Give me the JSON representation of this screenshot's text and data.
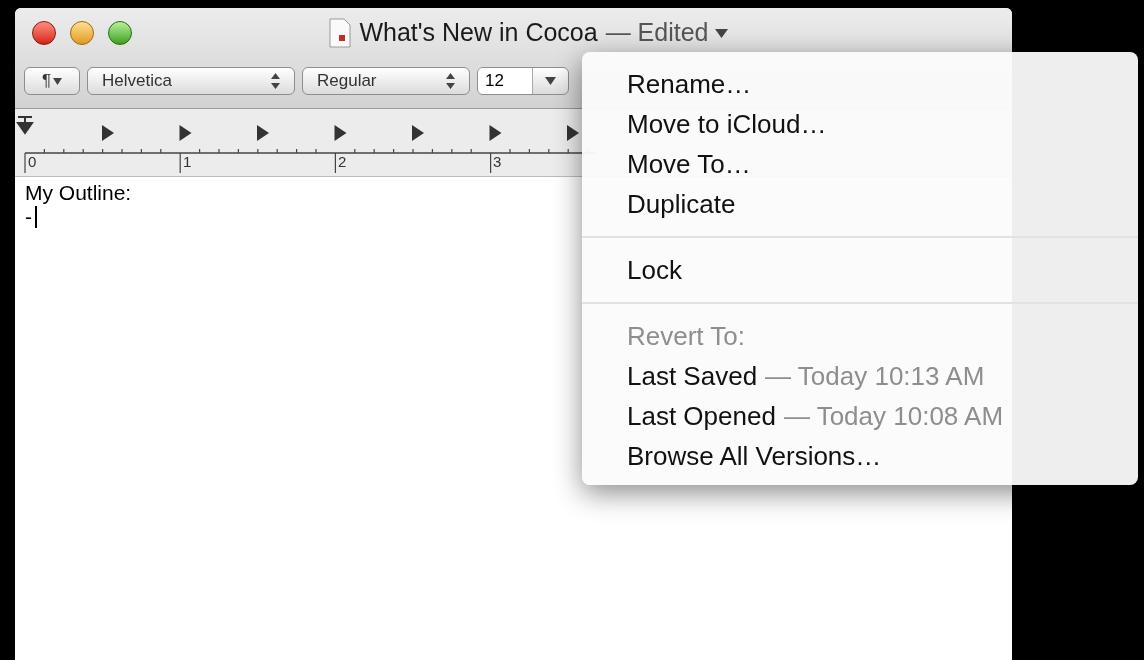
{
  "window": {
    "title": "What's New in Cocoa",
    "title_suffix": "— Edited"
  },
  "toolbar": {
    "paragraph_button": "¶",
    "font_family": "Helvetica",
    "font_style": "Regular",
    "font_size": "12"
  },
  "ruler": {
    "labels": [
      "0",
      "1",
      "2",
      "3"
    ]
  },
  "document": {
    "lines": [
      "My Outline:",
      "-"
    ]
  },
  "menu": {
    "sections": [
      {
        "items": [
          {
            "kind": "item",
            "label": "Rename…"
          },
          {
            "kind": "item",
            "label": "Move to iCloud…"
          },
          {
            "kind": "item",
            "label": "Move To…"
          },
          {
            "kind": "item",
            "label": "Duplicate"
          }
        ]
      },
      {
        "items": [
          {
            "kind": "item",
            "label": "Lock"
          }
        ]
      },
      {
        "items": [
          {
            "kind": "header",
            "label": "Revert To:"
          },
          {
            "kind": "item",
            "label": "Last Saved",
            "detail": "— Today 10:13 AM"
          },
          {
            "kind": "item",
            "label": "Last Opened",
            "detail": "— Today 10:08 AM"
          },
          {
            "kind": "item",
            "label": "Browse All Versions…"
          }
        ]
      }
    ]
  }
}
